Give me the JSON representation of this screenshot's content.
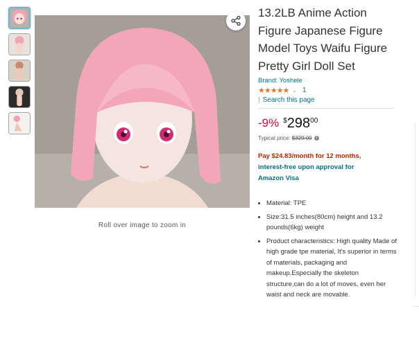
{
  "product": {
    "title": "13.2LB Anime Action Figure Japanese Figure Model Toys Waifu Figure Pretty Girl Doll Set",
    "brand": "Brand: Yoshele",
    "stars": "★★★★★",
    "rating_count": "1",
    "search_page": "Search this page"
  },
  "price": {
    "discount": "-9%",
    "currency": "$",
    "whole": "298",
    "fraction": "00",
    "typical_label": "Typical price:",
    "typical_value": "$329.00"
  },
  "promo": {
    "line1": "Pay $24.83/month for 12 months,",
    "line2": "interest-free upon approval for",
    "line3": "Amazon Visa"
  },
  "bullets": [
    "Material: TPE",
    "Size:31.5 inches(80cm) height and 13.2 pounds(6kg) weight",
    "Product characteristics: High quality Made of high grade tpe material, It's superior in terms of materials, packaging and makeup.Especially the skeleton structure,can do a lot of moves, even her waist and neck are movable."
  ],
  "gallery": {
    "rollover_text": "Roll over image to zoom in",
    "thumbnail_count": 5
  },
  "colors": {
    "link": "#007185",
    "star": "#de7921",
    "discount": "#cc0c39",
    "promo": "#b12704",
    "hair": "#f3a6b8"
  },
  "icons": {
    "share": "share-icon",
    "info": "info-icon",
    "chevron": "chevron-down-icon"
  }
}
